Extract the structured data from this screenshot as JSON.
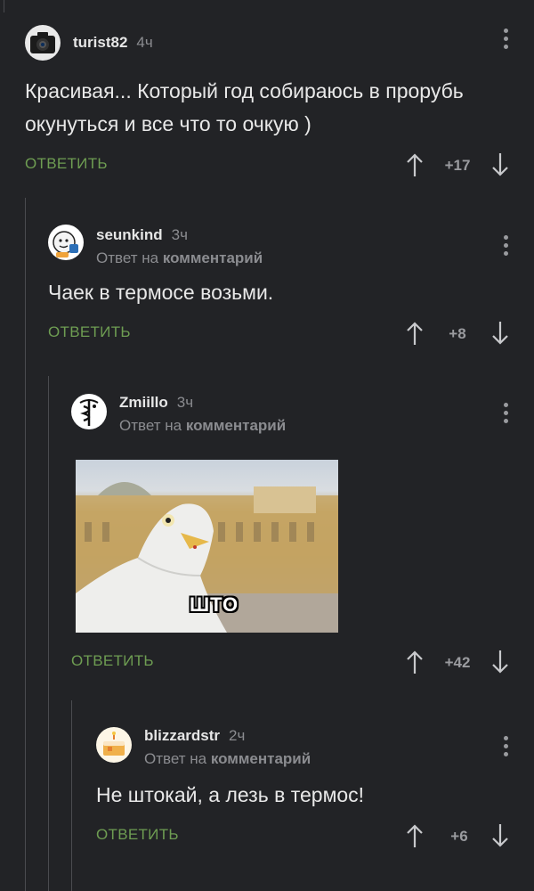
{
  "comments": [
    {
      "username": "turist82",
      "time": "4ч",
      "text": "Красивая... Который год собираюсь в прорубь окунуться и все что то очкую )",
      "reply_label": "ОТВЕТИТЬ",
      "rating": "+17",
      "avatar_icon": "camera-icon"
    },
    {
      "username": "seunkind",
      "time": "3ч",
      "reply_prefix": "Ответ на",
      "reply_target": "комментарий",
      "text": "Чаек в термосе возьми.",
      "reply_label": "ОТВЕТИТЬ",
      "rating": "+8",
      "avatar_icon": "cartoon-face-icon"
    },
    {
      "username": "Zmiillo",
      "time": "3ч",
      "reply_prefix": "Ответ на",
      "reply_target": "комментарий",
      "image_caption": "ШТО",
      "reply_label": "ОТВЕТИТЬ",
      "rating": "+42",
      "avatar_icon": "caduceus-icon"
    },
    {
      "username": "blizzardstr",
      "time": "2ч",
      "reply_prefix": "Ответ на",
      "reply_target": "комментарий",
      "text": "Не штокай, а лезь в термос!",
      "reply_label": "ОТВЕТИТЬ",
      "rating": "+6",
      "avatar_icon": "cake-icon"
    }
  ],
  "colors": {
    "background": "#222326",
    "reply_green": "#6e9d52",
    "muted": "#8b8c90"
  }
}
